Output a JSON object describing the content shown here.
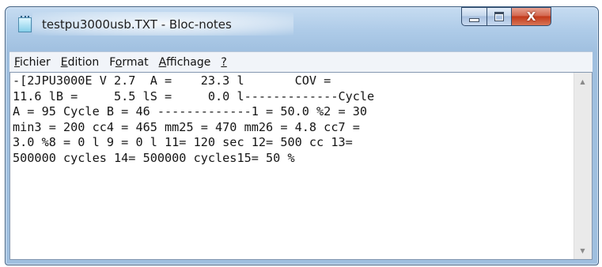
{
  "window": {
    "title": "testpu3000usb.TXT - Bloc-notes",
    "app_icon": "notepad-icon",
    "controls": {
      "minimize_icon": "minimize-icon",
      "maximize_icon": "maximize-icon",
      "close_glyph": "X"
    }
  },
  "menu": [
    {
      "underlined": "F",
      "rest": "ichier"
    },
    {
      "underlined": "E",
      "rest": "dition"
    },
    {
      "before": "F",
      "underlined": "o",
      "rest": "rmat"
    },
    {
      "underlined": "A",
      "rest": "ffichage"
    },
    {
      "underlined": "?",
      "rest": ""
    }
  ],
  "document": {
    "lines": [
      "-[2JPU3000E V 2.7  A =    23.3 l       COV =",
      "11.6 lB =     5.5 lS =     0.0 l-------------Cycle",
      "A = 95 Cycle B = 46 -------------1 = 50.0 %2 = 30",
      "min3 = 200 cc4 = 465 mm25 = 470 mm26 = 4.8 cc7 =",
      "3.0 %8 = 0 l 9 = 0 l 11= 120 sec 12= 500 cc 13=",
      "500000 cycles 14= 500000 cycles15= 50 %"
    ]
  },
  "scrollbar": {
    "up_arrow": "▲",
    "down_arrow": "▼"
  },
  "colors": {
    "titlebar": "#aecbe8",
    "close_button": "#c2391a",
    "menubar": "#f1f4f9",
    "editor_bg": "#ffffff"
  }
}
